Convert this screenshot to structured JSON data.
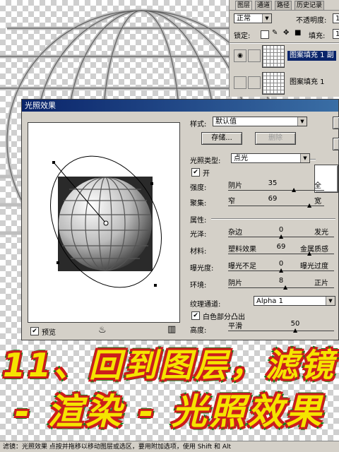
{
  "layers_panel": {
    "tabs": [
      "图层",
      "通道",
      "路径",
      "历史记录"
    ],
    "blend_mode": "正常",
    "opacity_label": "不透明度:",
    "opacity_value": "1",
    "lock_label": "锁定:",
    "fill_label": "填充:",
    "fill_value": "1",
    "layers": [
      {
        "name": "图案填充 1 副",
        "selected": true
      },
      {
        "name": "图案填充 1",
        "selected": false
      }
    ]
  },
  "dialog": {
    "title": "光照效果",
    "style_label": "样式:",
    "style_value": "默认值",
    "save_button": "存储...",
    "delete_button": "删除",
    "light_type_label": "光照类型:",
    "light_type_value": "点光",
    "on_label": "开",
    "intensity": {
      "label": "强度:",
      "left": "阴片",
      "value": "35",
      "right": "全"
    },
    "focus": {
      "label": "聚集:",
      "left": "窄",
      "value": "69",
      "right": "宽"
    },
    "properties_label": "属性:",
    "gloss": {
      "label": "光泽:",
      "left": "杂边",
      "value": "0",
      "right": "发光"
    },
    "material": {
      "label": "材料:",
      "left": "塑料效果",
      "value": "69",
      "right": "金属质感"
    },
    "exposure": {
      "label": "曝光度:",
      "left": "曝光不足",
      "value": "0",
      "right": "曝光过度"
    },
    "ambience": {
      "label": "环境:",
      "left": "阴片",
      "value": "8",
      "right": "正片"
    },
    "texture_channel_label": "纹理通道:",
    "texture_channel_value": "Alpha 1",
    "white_high_label": "白色部分凸出",
    "height": {
      "label": "高度:",
      "left": "平滑",
      "value": "50"
    },
    "preview_label": "预览"
  },
  "caption": {
    "line1": "11、回到图层，滤镜",
    "line2": "- 渲染 - 光照效果"
  },
  "status_bar": "滤镜：光照效果  点按并拖移以移动图层或选区，要用附加选项，使用 Shift 和 Alt"
}
